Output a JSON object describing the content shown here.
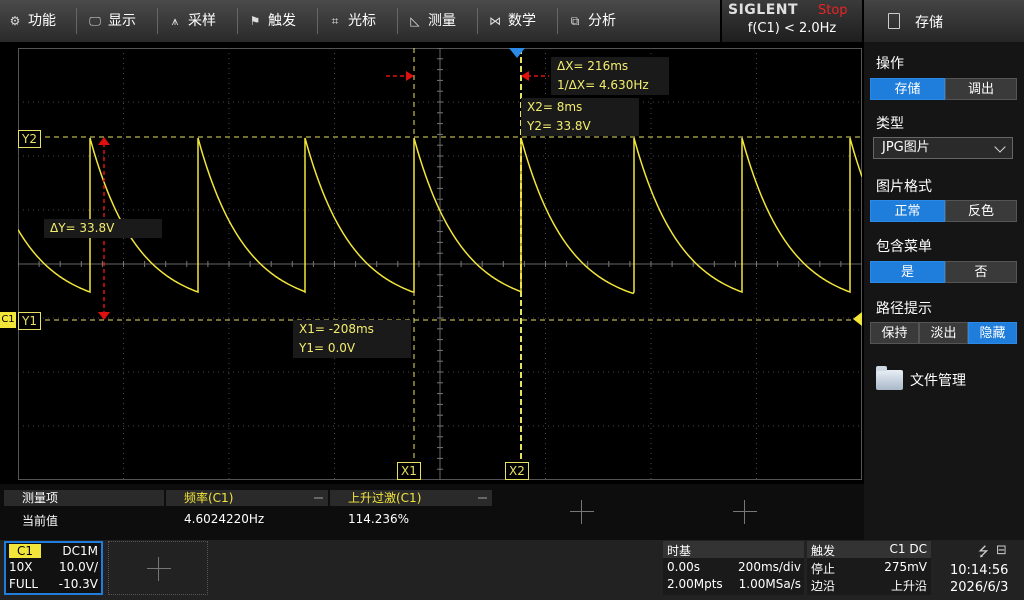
{
  "menu": [
    {
      "label": "功能",
      "icon": "gear-icon"
    },
    {
      "label": "显示",
      "icon": "monitor-icon"
    },
    {
      "label": "采样",
      "icon": "acquire-icon"
    },
    {
      "label": "触发",
      "icon": "flag-icon"
    },
    {
      "label": "光标",
      "icon": "crosshair-icon"
    },
    {
      "label": "测量",
      "icon": "ruler-icon"
    },
    {
      "label": "数学",
      "icon": "math-icon"
    },
    {
      "label": "分析",
      "icon": "analysis-icon"
    }
  ],
  "brand": "SIGLENT",
  "run_state": "Stop",
  "trigger_freq": "f(C1) < 2.0Hz",
  "right_panel": {
    "title": "存储",
    "operation_label": "操作",
    "operation_options": [
      "存储",
      "调出"
    ],
    "type_label": "类型",
    "type_value": "JPG图片",
    "format_label": "图片格式",
    "format_options": [
      "正常",
      "反色"
    ],
    "menu_label": "包含菜单",
    "menu_options": [
      "是",
      "否"
    ],
    "path_label": "路径提示",
    "path_options": [
      "保持",
      "淡出",
      "隐藏"
    ],
    "file_manager": "文件管理"
  },
  "cursors": {
    "y2_tag": "Y2",
    "y1_tag": "Y1",
    "x1_tag": "X1",
    "x2_tag": "X2",
    "ch_marker": "C1",
    "delta_x": "ΔX= 216ms",
    "inv_delta_x": "1/ΔX= 4.630Hz",
    "x2_readout": "X2= 8ms",
    "y2_readout": "Y2= 33.8V",
    "delta_y": "ΔY= 33.8V",
    "x1_readout": "X1= -208ms",
    "y1_readout": "Y1= 0.0V"
  },
  "measurements": {
    "header_label": "测量项",
    "row_label": "当前值",
    "columns": [
      {
        "name": "频率(C1)",
        "value": "4.6024220Hz"
      },
      {
        "name": "上升过激(C1)",
        "value": "114.236%"
      }
    ]
  },
  "channel": {
    "name": "C1",
    "coupling": "DC1M",
    "probe": "10X",
    "scale": "10.0V/",
    "bw": "FULL",
    "offset": "-10.3V"
  },
  "timebase": {
    "label": "时基",
    "delay": "0.00s",
    "scale": "200ms/div",
    "mem": "2.00Mpts",
    "rate": "1.00MSa/s"
  },
  "trigger": {
    "label": "触发",
    "source": "C1 DC",
    "level": "275mV",
    "state": "停止",
    "type": "边沿",
    "slope": "上升沿"
  },
  "clock": {
    "time": "10:14:56",
    "date": "2026/6/3"
  },
  "colors": {
    "trace": "#f3e63b",
    "cursor": "#e8e060",
    "accent": "#1f7ddb",
    "arrow": "#e11010"
  }
}
